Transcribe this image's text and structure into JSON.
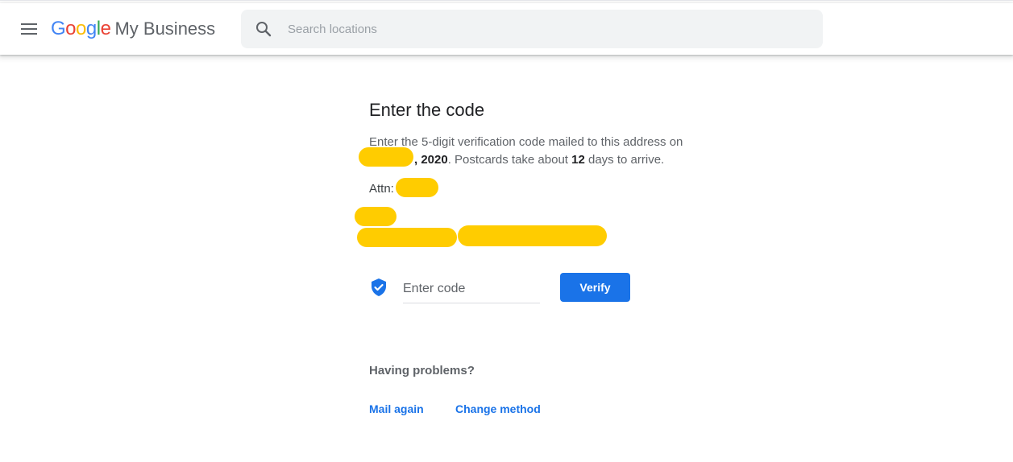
{
  "header": {
    "menu_icon": "hamburger-menu-icon",
    "logo_letters": [
      "G",
      "o",
      "o",
      "g",
      "l",
      "e"
    ],
    "product_name": "My Business",
    "search": {
      "icon": "search-icon",
      "placeholder": "Search locations",
      "value": ""
    }
  },
  "main": {
    "title": "Enter the code",
    "description_line1": "Enter the 5-digit verification code mailed to this address on",
    "date_year": ", 2020",
    "description_mid": ". Postcards take about ",
    "days_count": "12",
    "description_end": " days to arrive.",
    "attn_label": "Attn:",
    "code_input": {
      "icon": "verified-shield-icon",
      "placeholder": "Enter code",
      "value": ""
    },
    "verify_label": "Verify",
    "problems_heading": "Having problems?",
    "links": {
      "mail_again": "Mail again",
      "change_method": "Change method"
    }
  },
  "colors": {
    "accent": "#1a73e8",
    "redaction": "#ffcc00",
    "google_blue": "#4285f4",
    "google_red": "#ea4335",
    "google_yellow": "#fbbc05",
    "google_green": "#34a853"
  }
}
